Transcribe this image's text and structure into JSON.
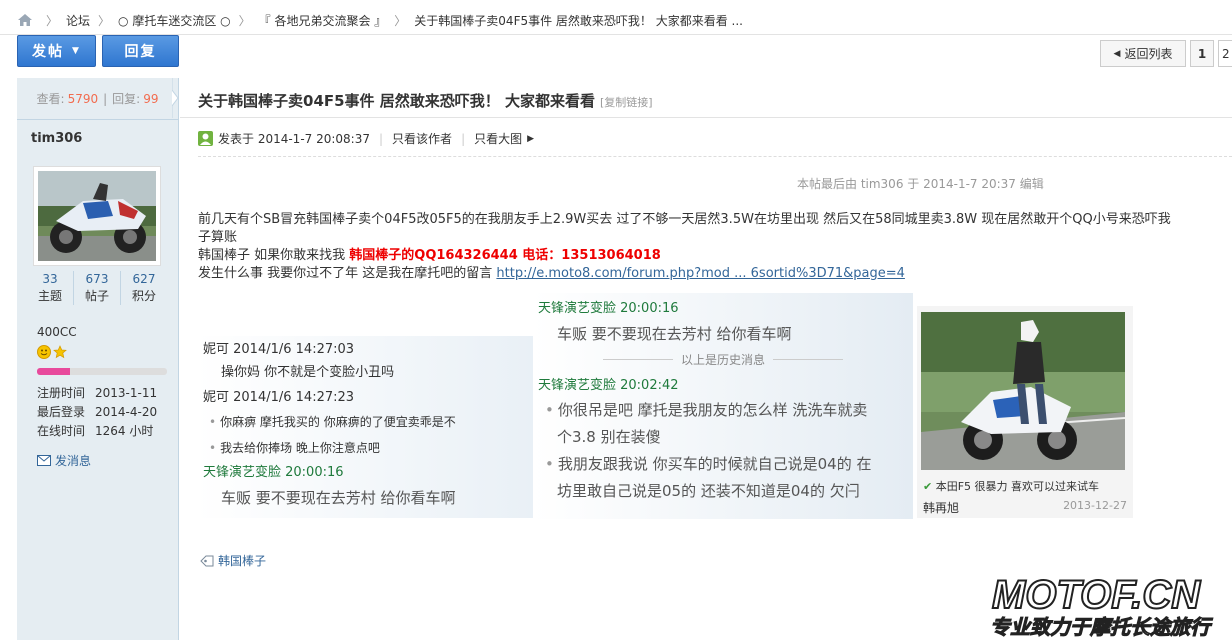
{
  "breadcrumb": {
    "items": [
      "论坛",
      "○ 摩托车迷交流区 ○",
      "『 各地兄弟交流聚会 』",
      "关于韩国棒子卖04F5事件 居然敢来恐吓我！ 大家都来看看 ..."
    ]
  },
  "toolbar": {
    "post_label": "发帖",
    "reply_label": "回复"
  },
  "pager": {
    "back_label": "返回列表",
    "current_page": "1",
    "next_page": "2"
  },
  "stats": {
    "views_label": "查看:",
    "views": "5790",
    "sep": "|",
    "replies_label": "回复:",
    "replies": "99"
  },
  "author": {
    "name": "tim306",
    "topics": "33",
    "topics_label": "主题",
    "posts": "673",
    "posts_label": "帖子",
    "points": "627",
    "points_label": "积分",
    "group": "400CC",
    "level_fill": 0.25,
    "reg_label": "注册时间",
    "reg_value": "2013-1-11",
    "last_label": "最后登录",
    "last_value": "2014-4-20",
    "online_label": "在线时间",
    "online_value": "1264 小时",
    "message_label": "发消息"
  },
  "thread": {
    "title": "关于韩国棒子卖04F5事件 居然敢来恐吓我！ 大家都来看看",
    "copy_link": "[复制链接]",
    "posted": "发表于 2014-1-7 20:08:37",
    "only_author": "只看该作者",
    "only_large": "只看大图",
    "edited": "本帖最后由 tim306 于 2014-1-7 20:37 编辑"
  },
  "post": {
    "line1": "前几天有个SB冒充韩国棒子卖个04F5改05F5的在我朋友手上2.9W买去   过了不够一天居然3.5W在坊里出现  然后又在58同城里卖3.8W  现在居然敢开个QQ小号来恐吓我",
    "line1b": "子算账",
    "line2_pre": "韩国棒子 如果你敢来找我   ",
    "line2_red": "韩国棒子的QQ164326444  电话：13513064018",
    "line3_pre": "发生什么事  我要你过不了年 这是我在摩托吧的留言 ",
    "line3_link": "http://e.moto8.com/forum.php?mod ... 6sortid%3D71&page=4"
  },
  "chat_left": {
    "n1": "妮可 2014/1/6 14:27:03",
    "m1": "操你妈 你不就是个变脸小丑吗",
    "n2": "妮可 2014/1/6 14:27:23",
    "m2": "你麻痹 摩托我买的  你麻痹的了便宜卖乖是不",
    "m3": "我去给你捧场  晚上你注意点吧",
    "n3": "天锋演艺变脸   20:00:16",
    "m4": "车贩  要不要现在去芳村 给你看车啊"
  },
  "chat_right": {
    "n1": "天锋演艺变脸   20:00:16",
    "m1": "车贩  要不要现在去芳村 给你看车啊",
    "history": "以上是历史消息",
    "n2": "天锋演艺变脸   20:02:42",
    "m2a": "你很吊是吧    摩托是我朋友的怎么样  洗洗车就卖",
    "m2b": "个3.8     别在装傻",
    "m3a": "我朋友跟我说   你买车的时候就自己说是04的   在",
    "m3b": "坊里敢自己说是05的   还装不知道是04的   欠闩"
  },
  "photo": {
    "caption": "本田F5 很暴力 喜欢可以过来试车",
    "name": "韩再旭",
    "date": "2013-12-27"
  },
  "tag": "韩国棒子",
  "watermark": {
    "brand": "MOTOF.CN",
    "slogan": "专业致力于摩托长途旅行"
  },
  "colors": {
    "accent_blue": "#2f76d0",
    "link": "#336699",
    "red": "#e00000",
    "sidebar_bg": "#e5edf2"
  }
}
